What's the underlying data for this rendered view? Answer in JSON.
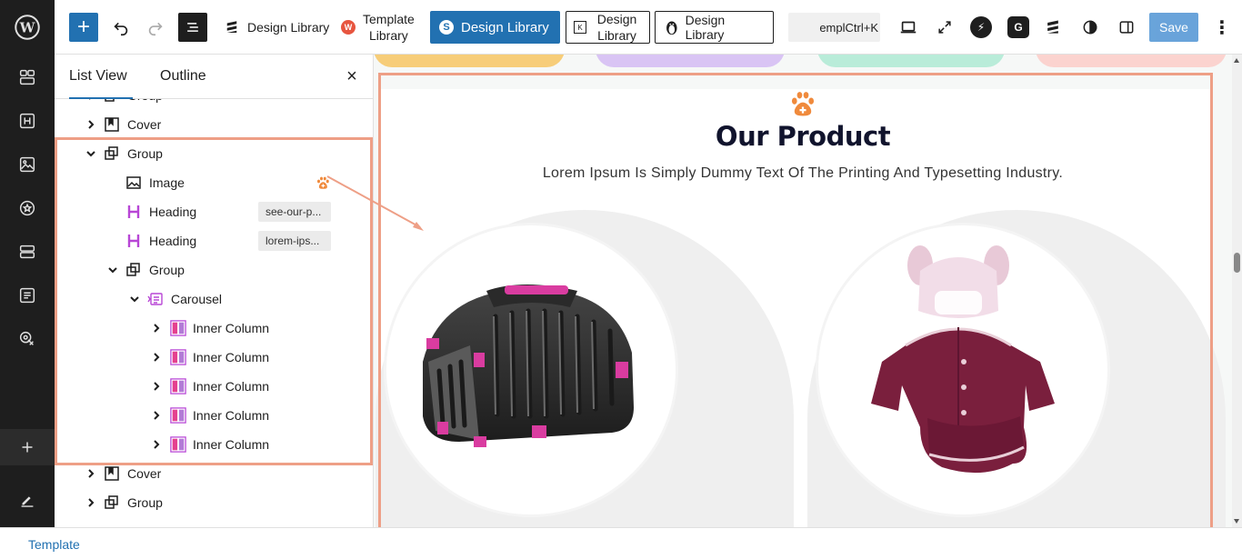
{
  "toolbar": {
    "add_label": "+",
    "design_library_1": "Design Library",
    "template_library_line1": "Template",
    "template_library_line2": "Library",
    "design_library_blue": "Design Library",
    "design_library_outline_line1": "Design",
    "design_library_outline_line2": "Library",
    "design_library_penguin": "Design Library",
    "search_text": "emplCtrl+K",
    "save_label": "Save",
    "accent_color": "#2271b1"
  },
  "listview": {
    "tabs": [
      {
        "label": "List View"
      },
      {
        "label": "Outline"
      }
    ],
    "close": "×",
    "rows": [
      {
        "label": "Group",
        "icon": "group-icon"
      },
      {
        "label": "Cover",
        "icon": "cover-icon"
      },
      {
        "label": "Group",
        "icon": "group-icon"
      },
      {
        "label": "Image",
        "icon": "image-icon"
      },
      {
        "label": "Heading",
        "icon": "heading-icon",
        "tag": "see-our-p..."
      },
      {
        "label": "Heading",
        "icon": "heading-icon",
        "tag": "lorem-ips..."
      },
      {
        "label": "Group",
        "icon": "group-icon"
      },
      {
        "label": "Carousel",
        "icon": "carousel-icon"
      },
      {
        "label": "Inner Column",
        "icon": "column-icon"
      },
      {
        "label": "Inner Column",
        "icon": "column-icon"
      },
      {
        "label": "Inner Column",
        "icon": "column-icon"
      },
      {
        "label": "Inner Column",
        "icon": "column-icon"
      },
      {
        "label": "Inner Column",
        "icon": "column-icon"
      },
      {
        "label": "Cover",
        "icon": "cover-icon"
      },
      {
        "label": "Group",
        "icon": "group-icon"
      }
    ]
  },
  "canvas": {
    "title": "Our Product",
    "subtitle": "Lorem Ipsum Is Simply Dummy Text Of The Printing And Typesetting Industry.",
    "pill_colors": [
      "#f7cd79",
      "#d9c4f4",
      "#b9ecd9",
      "#fbd3cf"
    ],
    "highlight_color": "#ee9f86",
    "paw_color": "#f08a3c"
  },
  "footer": {
    "breadcrumb": "Template"
  }
}
